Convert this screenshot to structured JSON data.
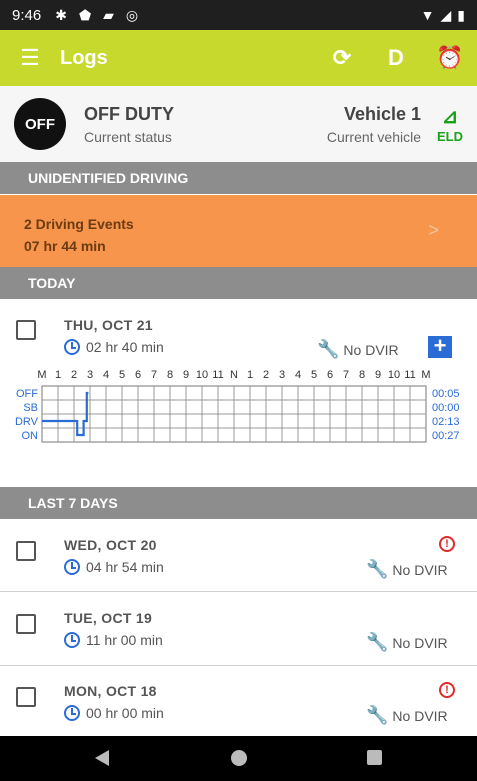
{
  "status_bar": {
    "time": "9:46"
  },
  "app_bar": {
    "title": "Logs",
    "duty_letter": "D"
  },
  "status": {
    "badge": "OFF",
    "title": "OFF DUTY",
    "subtitle": "Current status"
  },
  "vehicle": {
    "name": "Vehicle 1",
    "subtitle": "Current vehicle",
    "eld_label": "ELD"
  },
  "unidentified": {
    "header": "UNIDENTIFIED DRIVING",
    "events": "2 Driving Events",
    "duration": "07 hr  44 min"
  },
  "today": {
    "header": "TODAY",
    "date": "THU, OCT 21",
    "duration": "02 hr  40 min",
    "dvir": "No DVIR",
    "grid": {
      "hour_labels": [
        "M",
        "1",
        "2",
        "3",
        "4",
        "5",
        "6",
        "7",
        "8",
        "9",
        "10",
        "11",
        "N",
        "1",
        "2",
        "3",
        "4",
        "5",
        "6",
        "7",
        "8",
        "9",
        "10",
        "11",
        "M"
      ],
      "rows": [
        "OFF",
        "SB",
        "DRV",
        "ON"
      ],
      "totals": [
        "00:05",
        "00:00",
        "02:13",
        "00:27"
      ]
    }
  },
  "last7": {
    "header": "LAST 7 DAYS",
    "items": [
      {
        "date": "WED, OCT 20",
        "duration": "04 hr  54 min",
        "dvir": "No DVIR",
        "alert": true
      },
      {
        "date": "TUE, OCT 19",
        "duration": "11 hr  00 min",
        "dvir": "No DVIR",
        "alert": false
      },
      {
        "date": "MON, OCT 18",
        "duration": "00 hr  00 min",
        "dvir": "No DVIR",
        "alert": true
      }
    ]
  },
  "colors": {
    "accent": "#c6d92c",
    "blue": "#2b6bd6",
    "orange": "#f7954c",
    "eld_green": "#1aa21a",
    "alert_red": "#e02a2a"
  }
}
